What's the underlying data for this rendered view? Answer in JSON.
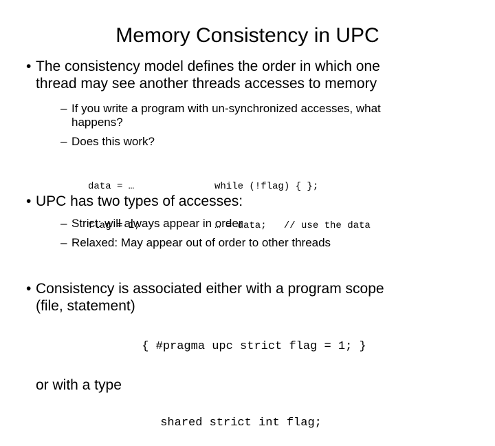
{
  "slide": {
    "title": "Memory Consistency in UPC",
    "bullet_glyph": "•",
    "dash_glyph": "–",
    "colors": {
      "background": "#ffffff",
      "text": "#000000"
    },
    "blocks": {
      "b1": {
        "line1": "The consistency model defines the order in which one",
        "line2": "thread may see another threads accesses to memory"
      },
      "b1_sub1": {
        "line1": "If you write a program with un-synchronized accesses, what",
        "line2": "happens?"
      },
      "b1_sub2": {
        "line1": "Does this work?"
      },
      "code1": {
        "left_line1": "data = …",
        "left_line2": "flag = 1;",
        "right_line1": "while (!flag) { };",
        "right_line2": "… = data;   // use the data"
      },
      "b2": {
        "line1": "UPC has two types of accesses:"
      },
      "b2_sub1": {
        "line1": "Strict: will always appear in order"
      },
      "b2_sub2": {
        "line1": "Relaxed: May appear out of order to other threads"
      },
      "b3": {
        "line1": "Consistency is associated either with a  program scope",
        "line2": "(file, statement)"
      },
      "code2": {
        "line1": "{ #pragma upc strict flag = 1; }"
      },
      "b4": {
        "line1": "or with a type"
      },
      "code3": {
        "line1": "shared strict int flag;"
      }
    }
  }
}
